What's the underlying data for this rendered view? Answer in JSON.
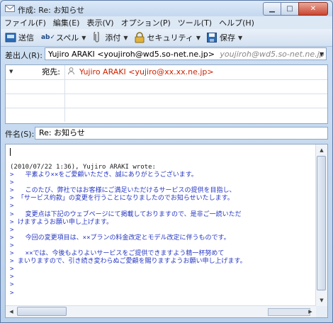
{
  "window": {
    "title": "作成: Re: お知らせ"
  },
  "menu": [
    "ファイル(F)",
    "編集(E)",
    "表示(V)",
    "オプション(P)",
    "ツール(T)",
    "ヘルプ(H)"
  ],
  "toolbar": {
    "send": "送信",
    "spell": "スペル",
    "attach": "添付",
    "security": "セキュリティ",
    "save": "保存"
  },
  "from": {
    "label": "差出人(R):",
    "account": "Yujiro ARAKI <youjiroh@wd5.so-net.ne.jp>",
    "account_hint": "youjiroh@wd5.so-net.ne.jp"
  },
  "recipients": [
    {
      "type": "宛先:",
      "address": "Yujiro ARAKI <yujiro@xx.xx.ne.jp>"
    },
    {
      "type": "",
      "address": ""
    },
    {
      "type": "",
      "address": ""
    },
    {
      "type": "",
      "address": ""
    }
  ],
  "subject": {
    "label": "件名(S):",
    "value": "Re: お知らせ"
  },
  "body": {
    "attribution": "(2010/07/22 1:36), Yujiro ARAKI wrote:",
    "quoted": [
      ">   平素より××をご愛顧いただき、誠にありがとうございます。",
      ">",
      ">   このたび、弊社ではお客様にご満足いただけるサービスの提供を目指し、",
      "> 「サービス約款」の変更を行うことになりましたのでお知らせいたします。",
      ">",
      ">   変更点は下記のウェブページにて掲載しておりますので、是非ご一読いただ",
      "> けますようお願い申し上げます。",
      ">",
      ">   今回の変更項目は、××プランの料金改定とモデル改定に伴うものです。",
      ">",
      ">   ××では、今後もよりよいサービスをご提供できますよう精一杯努めて",
      "> まいりますので、引き続き変わらぬご愛顧を賜りますようお願い申し上げます。",
      ">",
      ">",
      ">",
      ">"
    ]
  }
}
